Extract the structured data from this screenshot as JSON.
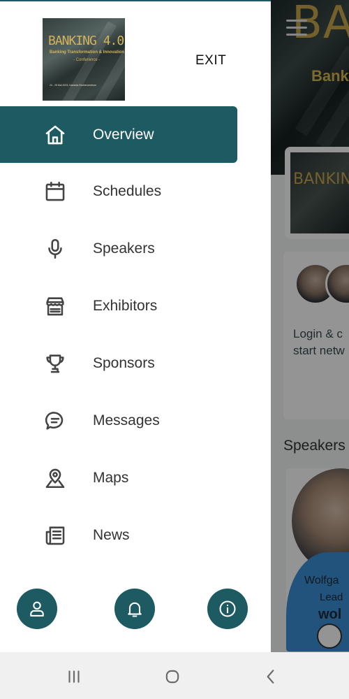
{
  "drawer": {
    "logo": {
      "title": "BANKING 4.0",
      "subtitle": "Banking Transformation & Innovation",
      "tagline": "- Conference -",
      "footer": "24 - 25 Mai 2023, Kameda Rechenzentrum"
    },
    "exit_label": "EXIT",
    "active_index": 0,
    "accent_color": "#1d5a62",
    "items": [
      {
        "label": "Overview",
        "icon": "home-icon"
      },
      {
        "label": "Schedules",
        "icon": "calendar-icon"
      },
      {
        "label": "Speakers",
        "icon": "microphone-icon"
      },
      {
        "label": "Exhibitors",
        "icon": "storefront-icon"
      },
      {
        "label": "Sponsors",
        "icon": "trophy-icon"
      },
      {
        "label": "Messages",
        "icon": "chat-bubble-icon"
      },
      {
        "label": "Maps",
        "icon": "map-pin-icon"
      },
      {
        "label": "News",
        "icon": "newspaper-icon"
      }
    ],
    "bottom_actions": [
      {
        "icon": "user-icon"
      },
      {
        "icon": "bell-icon"
      },
      {
        "icon": "info-icon"
      }
    ]
  },
  "background_app": {
    "hero_text": "BA",
    "hero_sub": "Banki",
    "thumb_text": "BANKING",
    "card_text_1": "Login & c",
    "card_text_2": "start netw",
    "speakers_heading": "Speakers",
    "speaker_name": "Wolfga",
    "speaker_role": "Lead",
    "speaker_logo": "wol"
  },
  "system_nav": {
    "buttons": [
      "recent-apps-icon",
      "home-circle-icon",
      "back-chevron-icon"
    ]
  }
}
